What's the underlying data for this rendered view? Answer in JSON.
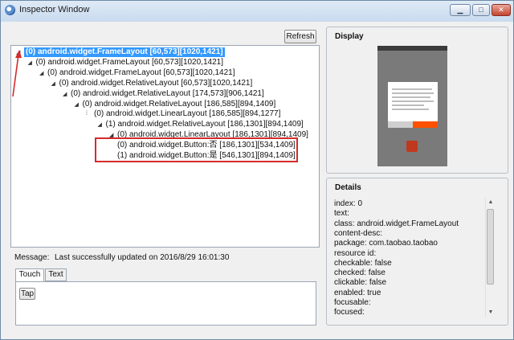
{
  "window": {
    "title": "Inspector Window",
    "minimize_glyph": "▁",
    "maximize_glyph": "□",
    "close_glyph": "✕"
  },
  "toolbar": {
    "refresh_label": "Refresh"
  },
  "tree": {
    "nodes": [
      {
        "text": "(0) android.widget.FrameLayout [60,573][1020,1421]",
        "toggle": "◢",
        "selected": true
      },
      {
        "text": "(0) android.widget.FrameLayout [60,573][1020,1421]",
        "toggle": "◢"
      },
      {
        "text": "(0) android.widget.FrameLayout [60,573][1020,1421]",
        "toggle": "◢"
      },
      {
        "text": "(0) android.widget.RelativeLayout [60,573][1020,1421]",
        "toggle": "◢"
      },
      {
        "text": "(0) android.widget.RelativeLayout [174,573][906,1421]",
        "toggle": "◢"
      },
      {
        "text": "(0) android.widget.RelativeLayout [186,585][894,1409]",
        "toggle": "◢"
      },
      {
        "text": "(0) android.widget.LinearLayout [186,585][894,1277]",
        "toggle": "⁞"
      },
      {
        "text": "(1) android.widget.RelativeLayout [186,1301][894,1409]",
        "toggle": "◢"
      },
      {
        "text": "(0) android.widget.LinearLayout [186,1301][894,1409]",
        "toggle": "◢"
      },
      {
        "text": "(0) android.widget.Button:否 [186,1301][534,1409]",
        "toggle": ""
      },
      {
        "text": "(1) android.widget.Button:是 [546,1301][894,1409]",
        "toggle": ""
      }
    ]
  },
  "message": {
    "label": "Message:",
    "text": "Last successfully updated on 2016/8/29 16:01:30"
  },
  "tabs": [
    {
      "label": "Touch",
      "active": true
    },
    {
      "label": "Text",
      "active": false
    }
  ],
  "touch": {
    "tap_label": "Tap"
  },
  "display": {
    "title": "Display"
  },
  "details": {
    "title": "Details",
    "lines": [
      "index: 0",
      "text:",
      "class: android.widget.FrameLayout",
      "content-desc:",
      "package: com.taobao.taobao",
      "resource id:",
      "checkable: false",
      "checked: false",
      "clickable: false",
      "enabled: true",
      "focusable:",
      "focused:"
    ]
  },
  "colors": {
    "selection": "#3399ff",
    "highlight_box": "#d42b2b",
    "close_button": "#c24430"
  },
  "icons": {
    "tree_expanded": "triangle-expanded-icon",
    "annotation": "red-arrow-icon"
  }
}
